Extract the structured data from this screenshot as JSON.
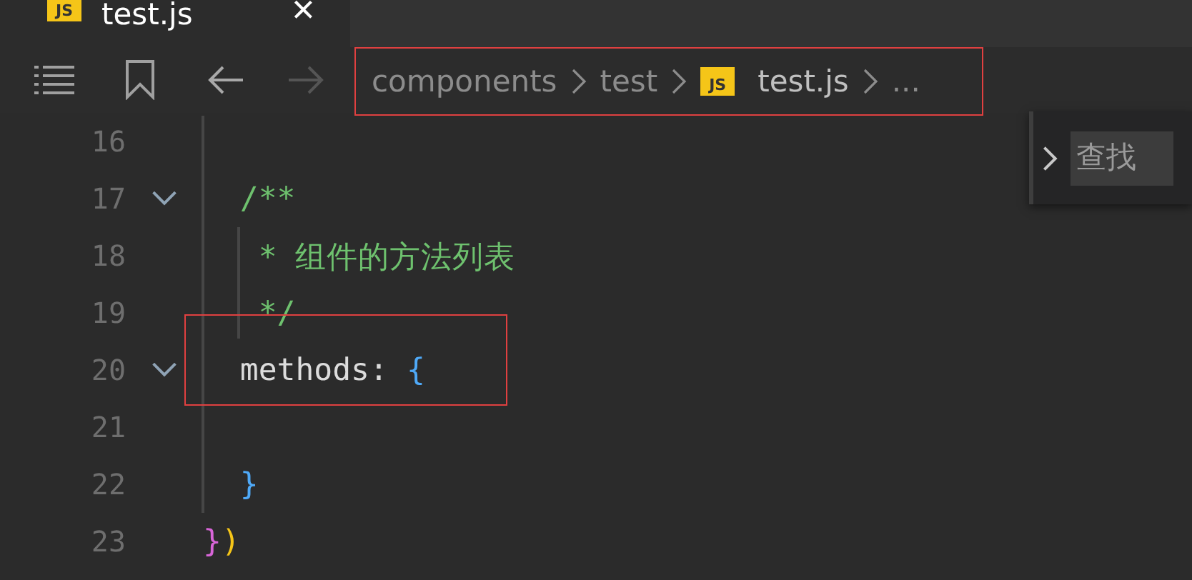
{
  "tab": {
    "icon_label": "JS",
    "title": "test.js",
    "close": "×"
  },
  "toolbar": {
    "back_disabled": false,
    "forward_disabled": true
  },
  "breadcrumb": {
    "highlighted": true,
    "items": [
      {
        "kind": "folder",
        "label": "components"
      },
      {
        "kind": "folder",
        "label": "test"
      },
      {
        "kind": "file",
        "icon_label": "JS",
        "label": "test.js"
      },
      {
        "kind": "more",
        "label": "..."
      }
    ]
  },
  "find_widget": {
    "placeholder": "查找",
    "expanded": false
  },
  "lines": [
    {
      "number": "16",
      "fold": false,
      "highlighted": false
    },
    {
      "number": "17",
      "fold": true,
      "highlighted": false,
      "tokens": [
        {
          "kind": "comment",
          "text": "  /**"
        }
      ]
    },
    {
      "number": "18",
      "fold": false,
      "highlighted": false,
      "tokens": [
        {
          "kind": "comment",
          "text": "   * 组件的方法列表"
        }
      ]
    },
    {
      "number": "19",
      "fold": false,
      "highlighted": false,
      "tokens": [
        {
          "kind": "comment",
          "text": "   */"
        }
      ]
    },
    {
      "number": "20",
      "fold": true,
      "highlighted": true,
      "tokens": [
        {
          "kind": "property",
          "text": "  methods"
        },
        {
          "kind": "punctuation",
          "text": ":"
        },
        {
          "kind": "bracket",
          "text": "{",
          "color": "#4fa9f7"
        }
      ]
    },
    {
      "number": "21",
      "fold": false,
      "highlighted": false
    },
    {
      "number": "22",
      "fold": false,
      "highlighted": false,
      "tokens": [
        {
          "kind": "bracket",
          "text": "  }",
          "color": "#4fa9f7"
        }
      ]
    },
    {
      "number": "23",
      "fold": false,
      "highlighted": false,
      "tokens": [
        {
          "kind": "bracket",
          "text": "}",
          "color": "#d865d8"
        },
        {
          "kind": "bracket",
          "text": ")",
          "color": "#f5c518"
        }
      ]
    }
  ]
}
